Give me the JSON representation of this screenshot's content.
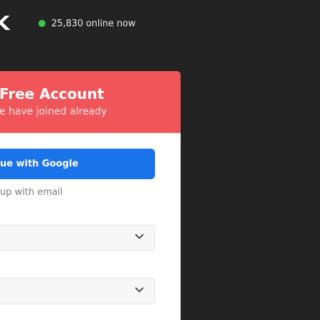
{
  "header": {
    "logo_fragment": "K",
    "online_count_text": "25,830 online now",
    "online_dot_color": "#3cc44f"
  },
  "card": {
    "title": "Free Account",
    "subtitle": "e have joined already",
    "header_color": "#f0555a",
    "google_button_label": "ue with Google",
    "google_button_color": "#1a73e8",
    "divider_text": "up with email",
    "selects": [
      {
        "value": "",
        "icon": "chevron-down-icon"
      },
      {
        "value": "",
        "icon": "chevron-down-icon"
      }
    ]
  }
}
